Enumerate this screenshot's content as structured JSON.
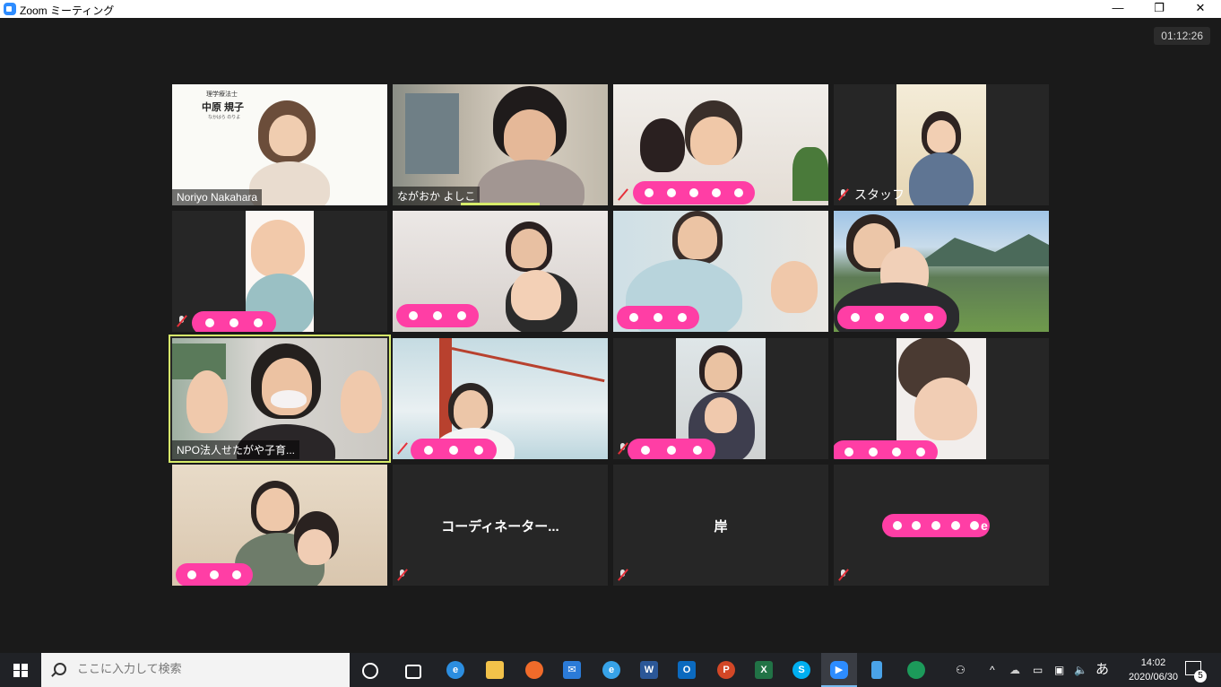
{
  "window": {
    "title": "Zoom ミーティング",
    "minimize": "—",
    "restore": "❐",
    "close": "✕"
  },
  "meeting": {
    "timer": "01:12:26"
  },
  "participants": [
    {
      "name": "Noriyo Nakahara",
      "muted": false,
      "video": true,
      "redacted": false
    },
    {
      "name": "ながおか よしこ",
      "muted": false,
      "video": true,
      "redacted": false
    },
    {
      "name": "",
      "muted": true,
      "video": true,
      "redacted": true
    },
    {
      "name": "スタッフ",
      "muted": true,
      "video": true,
      "redacted": false
    },
    {
      "name": "",
      "muted": true,
      "video": true,
      "redacted": true
    },
    {
      "name": "",
      "muted": false,
      "video": true,
      "redacted": true
    },
    {
      "name": "",
      "muted": false,
      "video": true,
      "redacted": true
    },
    {
      "name": "",
      "muted": false,
      "video": true,
      "redacted": true
    },
    {
      "name": "NPO法人せたがや子育...",
      "muted": false,
      "video": true,
      "redacted": false,
      "active_speaker": true
    },
    {
      "name": "",
      "muted": true,
      "video": true,
      "redacted": true
    },
    {
      "name": "",
      "muted": true,
      "video": true,
      "redacted": true
    },
    {
      "name": "",
      "muted": false,
      "video": true,
      "redacted": true
    },
    {
      "name": "",
      "muted": false,
      "video": true,
      "redacted": true
    },
    {
      "name": "コーディネーター...",
      "muted": true,
      "video": false,
      "redacted": false
    },
    {
      "name": "岸",
      "muted": true,
      "video": false,
      "redacted": false
    },
    {
      "name": "e",
      "muted": true,
      "video": false,
      "redacted": true
    }
  ],
  "tile1_overlay": {
    "line1": "理学療法士",
    "line2": "中原 規子",
    "line3": "なかはら のりよ"
  },
  "taskbar": {
    "search_placeholder": "ここに入力して検索",
    "ime": "あ",
    "time": "14:02",
    "date": "2020/06/30",
    "notifications": "5",
    "apps": [
      "cortana-icon",
      "task-view-icon",
      "edge-icon",
      "file-explorer-icon",
      "avast-icon",
      "mail-icon",
      "ie-icon",
      "word-icon",
      "outlook-icon",
      "powerpoint-icon",
      "excel-icon",
      "skype-icon",
      "zoom-icon",
      "phone-icon",
      "meet-icon"
    ]
  },
  "colors": {
    "active_speaker_border": "#d7ec6a",
    "redaction": "#ff3ea5",
    "muted_icon": "#e6303a",
    "zoom_blue": "#2d8cff"
  }
}
